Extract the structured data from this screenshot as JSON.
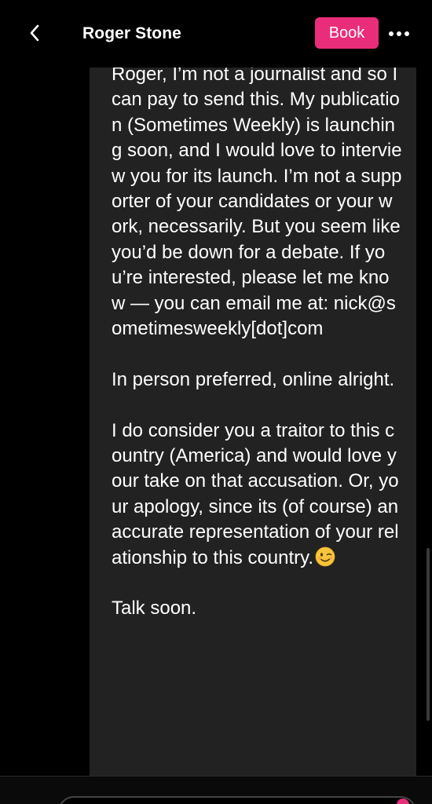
{
  "header": {
    "title": "Roger Stone",
    "book_label": "Book",
    "back_icon": "chevron-left-icon",
    "more_icon": "more-horizontal-icon"
  },
  "message": {
    "paragraphs": [
      "Roger, I’m not a journalist and so I can pay to send this. My publication (Sometimes Weekly) is launching soon, and I would love to interview you for its launch. I’m not a supporter of your candidates or your work, necessarily. But you seem like you’d be down for a debate. If you’re interested, please let me know — you can email me at: nick@sometimesweekly[dot]com",
      "In person preferred, online alright.",
      "I do consider you a traitor to this country (America) and would love your take on that accusation. Or, your apology, since its (of course) an accurate representation of your relationship to this country.",
      "Talk soon."
    ],
    "emoji": "winking-face-emoji"
  },
  "colors": {
    "background": "#000000",
    "bubble": "#222222",
    "accent": "#ea2d7a",
    "text": "#ffffff"
  }
}
